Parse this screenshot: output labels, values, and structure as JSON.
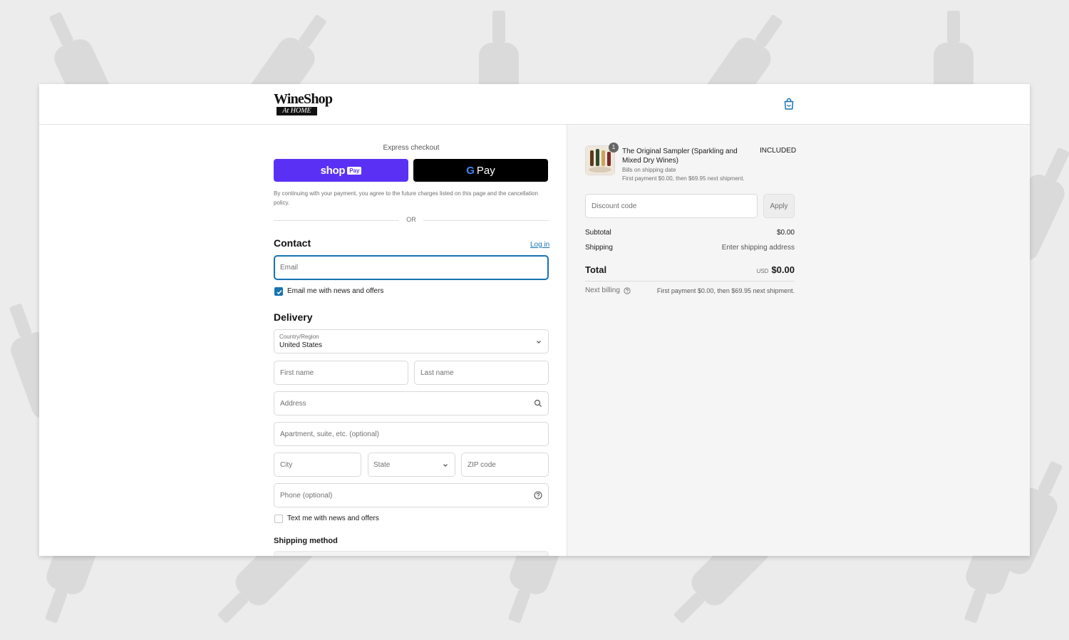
{
  "header": {
    "logo_top": "WineShop",
    "logo_bottom": "At HOME"
  },
  "express": {
    "title": "Express checkout",
    "shop_label": "shop",
    "shop_pill": "Pay",
    "gpay_g": "G",
    "gpay_label": "Pay",
    "consent": "By continuing with your payment, you agree to the future charges listed on this page and the cancellation policy.",
    "or": "OR"
  },
  "contact": {
    "title": "Contact",
    "login": "Log in",
    "email_placeholder": "Email",
    "news_label": "Email me with news and offers",
    "news_checked": true
  },
  "delivery": {
    "title": "Delivery",
    "country_label": "Country/Region",
    "country_value": "United States",
    "first_name_placeholder": "First name",
    "last_name_placeholder": "Last name",
    "address_placeholder": "Address",
    "apartment_placeholder": "Apartment, suite, etc. (optional)",
    "city_placeholder": "City",
    "state_placeholder": "State",
    "zip_placeholder": "ZIP code",
    "phone_placeholder": "Phone (optional)",
    "text_label": "Text me with news and offers",
    "text_checked": false,
    "shipping_method_title": "Shipping method"
  },
  "summary": {
    "item": {
      "quantity": "1",
      "name": "The Original Sampler (Sparkling and Mixed Dry Wines)",
      "price": "INCLUDED",
      "sub1": "Bills on shipping date",
      "sub2": "First payment $0.00, then $69.95 next shipment."
    },
    "discount_placeholder": "Discount code",
    "apply_label": "Apply",
    "subtotal_label": "Subtotal",
    "subtotal_value": "$0.00",
    "shipping_label": "Shipping",
    "shipping_value": "Enter shipping address",
    "total_label": "Total",
    "total_currency": "USD",
    "total_value": "$0.00",
    "next_billing_label": "Next billing",
    "next_billing_value": "First payment $0.00, then $69.95 next shipment."
  },
  "colors": {
    "accent": "#1773b0",
    "shop_pay": "#5a31f4",
    "gpay": "#000000",
    "summary_bg": "#f5f5f5",
    "page_bg": "#ececec"
  }
}
